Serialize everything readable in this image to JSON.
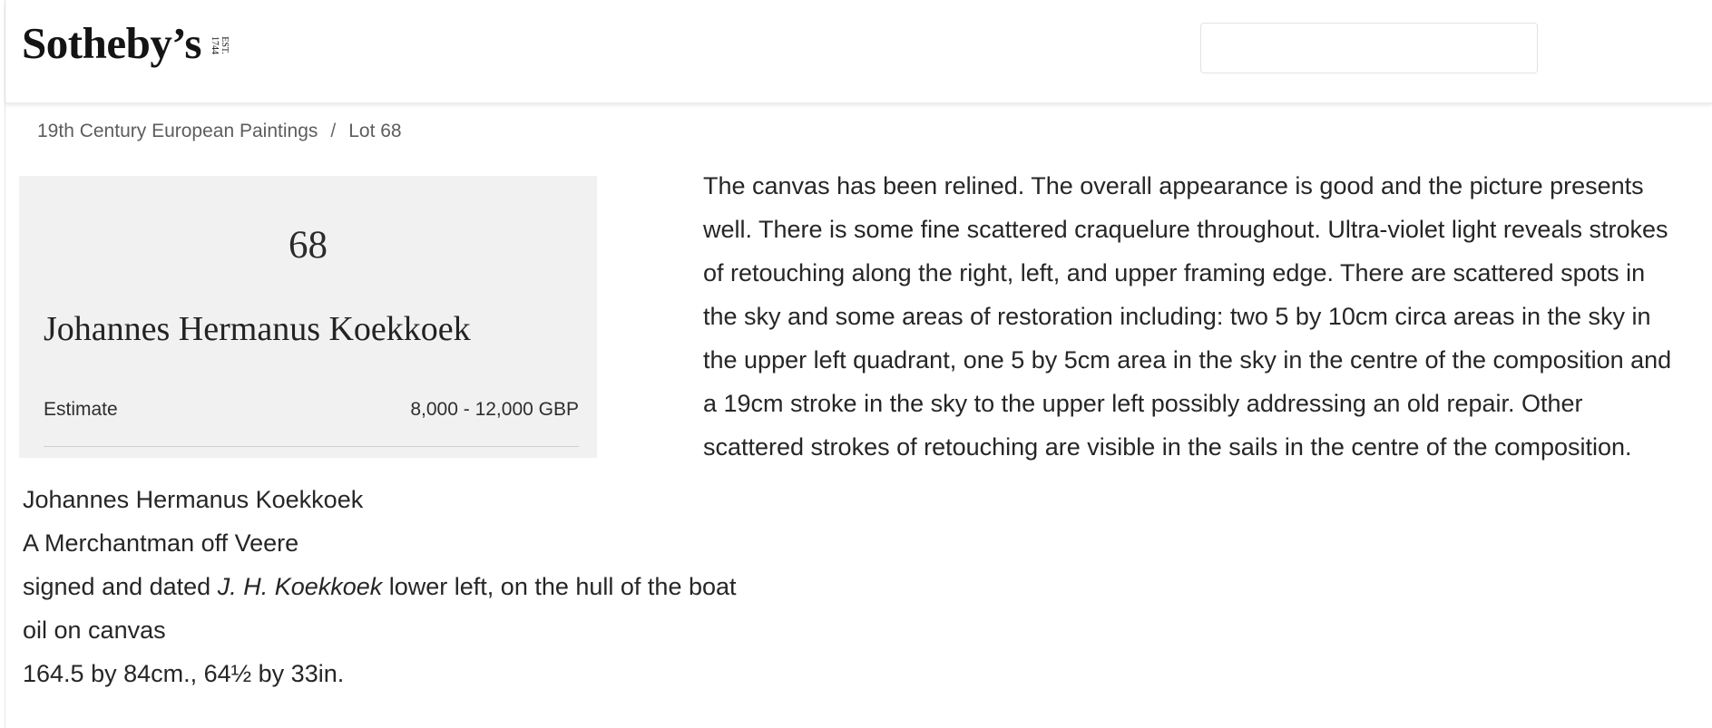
{
  "header": {
    "logo_text": "Sotheby’s",
    "logo_est_line1": "EST.",
    "logo_est_line2": "1744",
    "search_placeholder": ""
  },
  "breadcrumb": {
    "sale": "19th Century European Paintings",
    "separator": "/",
    "lot": "Lot 68"
  },
  "lot_card": {
    "number": "68",
    "artist": "Johannes Hermanus Koekkoek",
    "estimate_label": "Estimate",
    "estimate_value": "8,000 - 12,000 GBP"
  },
  "catalogue_note": {
    "line1": "Johannes Hermanus Koekkoek",
    "line2": "A Merchantman off Veere",
    "line3_before": "signed and dated ",
    "line3_italic": "J. H. Koekkoek",
    "line3_after": " lower left, on the hull of the boat",
    "line4": "oil on canvas",
    "line5": "164.5 by 84cm., 64½ by 33in."
  },
  "condition_report": {
    "text": "The canvas has been relined. The overall appearance is good and the picture presents well. There is some fine scattered craquelure throughout. Ultra-violet light reveals strokes of retouching along the right, left, and upper framing edge. There are scattered spots in the sky and some areas of restoration including: two 5 by 10cm circa areas in the sky in the upper left quadrant, one 5 by 5cm area in the sky in the centre of the composition and a 19cm stroke in the sky to the upper left possibly addressing an old repair. Other scattered strokes of retouching are visible in the sails in the centre of the composition."
  }
}
